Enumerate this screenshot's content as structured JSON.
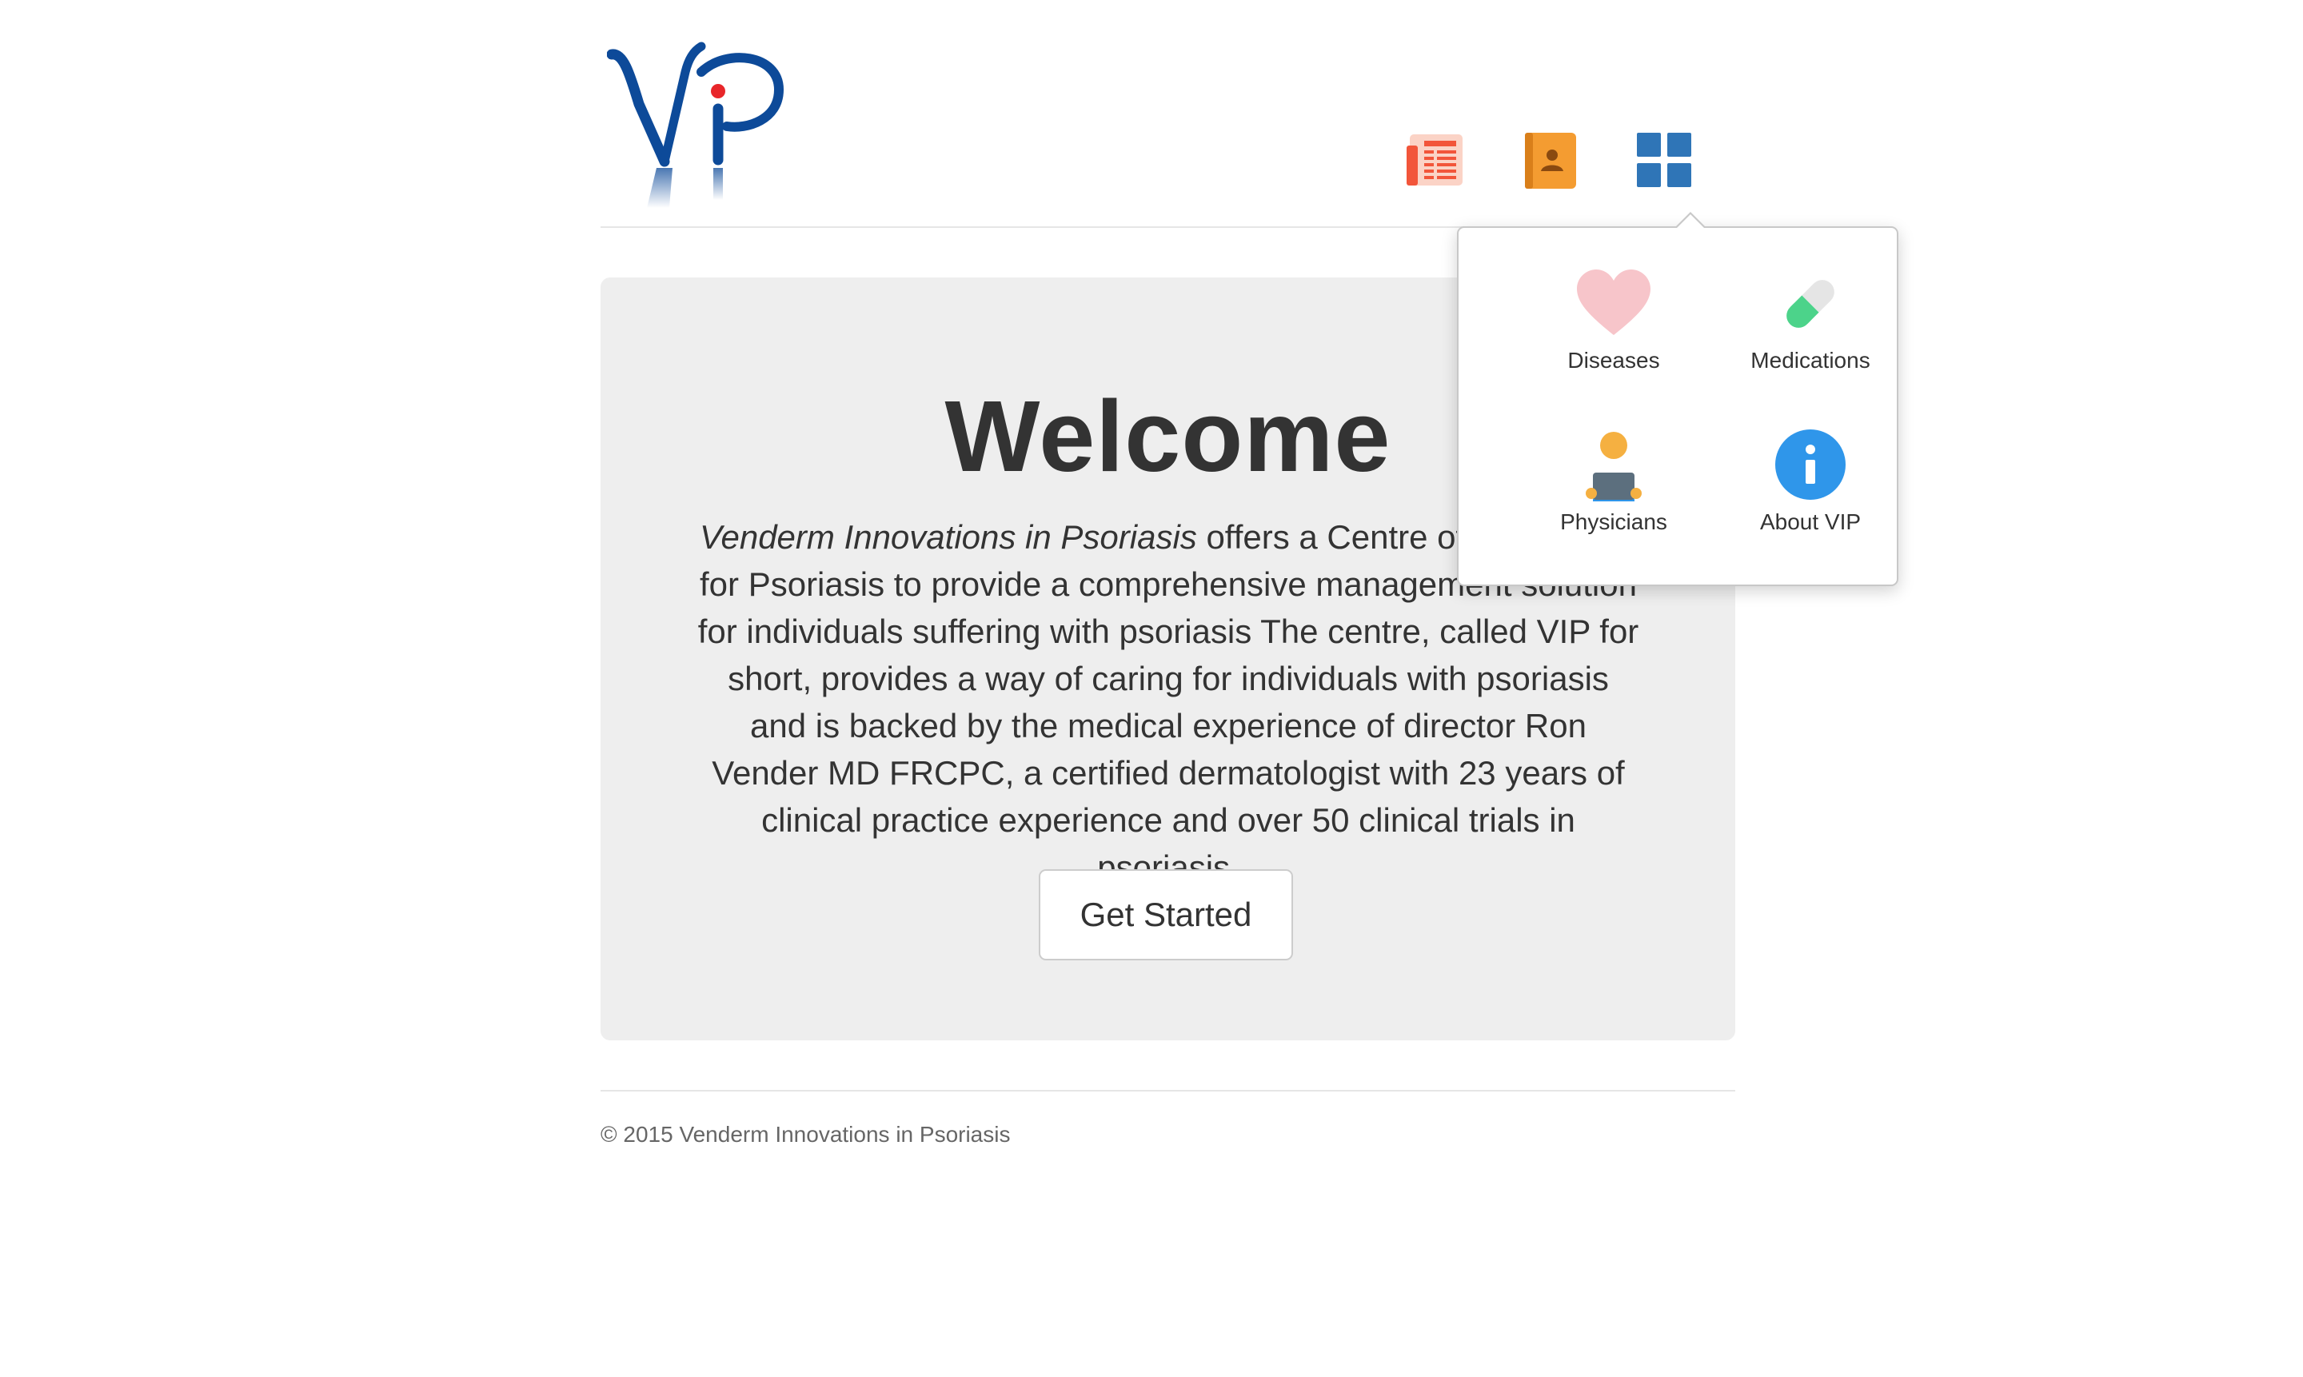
{
  "brand": {
    "logo_text": "ViP",
    "logo_blue": "#0d4a99",
    "logo_red": "#e8262a"
  },
  "nav": {
    "icons": [
      {
        "name": "newspaper-icon",
        "color": "#f2553a"
      },
      {
        "name": "contact-book-icon",
        "color": "#f49c31"
      },
      {
        "name": "grid-menu-icon",
        "color": "#2f75b7"
      }
    ]
  },
  "jumbotron": {
    "title": "Welcome",
    "intro_italic": "Venderm Innovations in Psoriasis",
    "intro_rest": " offers a Centre of Excellence for Psoriasis to provide a comprehensive management solution for individuals suffering with psoriasis The centre, called VIP for short, provides a way of caring for individuals with psoriasis and is backed by the medical experience of director Ron Vender MD FRCPC, a certified dermatologist with 23 years of clinical practice experience and over 50 clinical trials in psoriasis.",
    "cta_label": "Get Started"
  },
  "menu_popover": {
    "items": [
      {
        "label": "Diseases",
        "icon": "heart-icon",
        "color": "#f7c5ca"
      },
      {
        "label": "Medications",
        "icon": "pill-icon",
        "color": "#4cd38a"
      },
      {
        "label": "Physicians",
        "icon": "physician-icon",
        "color": "#f5b041"
      },
      {
        "label": "About VIP",
        "icon": "info-icon",
        "color": "#2f96ea"
      }
    ]
  },
  "footer": {
    "copyright": "© 2015 Venderm Innovations in Psoriasis"
  }
}
